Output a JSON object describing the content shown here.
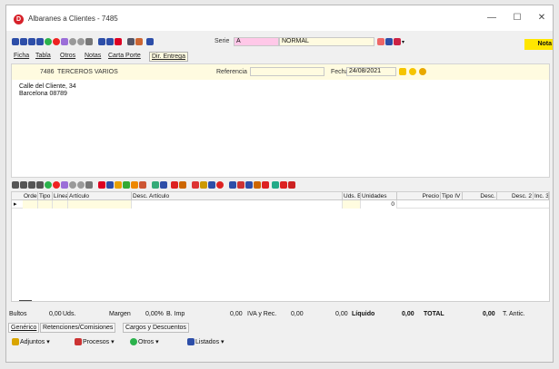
{
  "window": {
    "title": "Albaranes a Clientes - 7485",
    "controls": {
      "minimize": "—",
      "maximize": "☐",
      "close": "✕"
    }
  },
  "toolbar": {
    "serie_label": "Serie",
    "serie_value": "A",
    "serie_desc": "NORMAL",
    "notas_flag": "Nota"
  },
  "tabs": [
    "Ficha",
    "Tabla",
    "Otros",
    "Notas",
    "Carta Porte",
    "Dir. Entrega"
  ],
  "header": {
    "client_code": "7486",
    "client_name": "TERCEROS VARIOS",
    "referencia_label": "Referencia",
    "fecha_label": "Fecha",
    "fecha_value": "24/08/2021"
  },
  "address": {
    "line1": "Calle del Cliente, 34",
    "line2": "Barcelona 08789"
  },
  "grid": {
    "columns": [
      "Orden",
      "Tipo",
      "Líneas",
      "Artículo",
      "Desc. Artículo",
      "Uds. E",
      "Unidades",
      "Precio",
      "Tipo IV",
      "Desc.",
      "Desc. 2",
      "Inc. 3"
    ],
    "row": {
      "unidades": "0"
    }
  },
  "totals": {
    "bultos_label": "Bultos",
    "bultos_value": "0,00",
    "uds_label": "Uds.",
    "margen_label": "Margen",
    "margen_value": "0,00%",
    "bimp_label": "B. Imp",
    "bimp_value": "0,00",
    "iva_label": "IVA y Rec.",
    "iva_value": "0,00",
    "rec_value": "0,00",
    "liquido_label": "Líquido",
    "liquido_value": "0,00",
    "total_label": "TOTAL",
    "total_value": "0,00",
    "tanti_label": "T. Antic."
  },
  "bottom_tabs": [
    "Genérico",
    "Retenciones/Comisiones",
    "Cargos y Descuentos"
  ],
  "bottom_buttons": [
    "Adjuntos",
    "Procesos",
    "Otros",
    "Listados"
  ],
  "colors": {
    "accent_yellow": "#ffe600",
    "serie_pink": "#ffc8e8",
    "nav_blue": "#2d4ea8"
  }
}
